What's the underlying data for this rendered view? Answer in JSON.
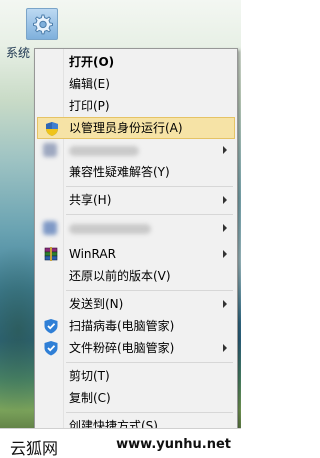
{
  "desktop": {
    "icon_label": "系统"
  },
  "context_menu": {
    "items": [
      {
        "label": "打开(O)",
        "bold": true
      },
      {
        "label": "编辑(E)"
      },
      {
        "label": "打印(P)"
      },
      {
        "label": "以管理员身份运行(A)",
        "icon": "uac-shield-icon",
        "highlighted": true
      },
      {
        "label": "",
        "blurred": true,
        "submenu": true
      },
      {
        "label": "兼容性疑难解答(Y)"
      },
      {
        "label": "共享(H)",
        "submenu": true
      },
      {
        "label": "",
        "blurred": true,
        "submenu": true
      },
      {
        "label": "WinRAR",
        "icon": "winrar-books-icon",
        "submenu": true
      },
      {
        "label": "还原以前的版本(V)"
      },
      {
        "label": "发送到(N)",
        "submenu": true
      },
      {
        "label": "扫描病毒(电脑管家)",
        "icon": "pc-manager-shield-icon"
      },
      {
        "label": "文件粉碎(电脑管家)",
        "icon": "pc-manager-shield-icon",
        "submenu": true
      },
      {
        "label": "剪切(T)"
      },
      {
        "label": "复制(C)"
      },
      {
        "label": "创建快捷方式(S)",
        "partial": true
      }
    ]
  },
  "watermark": {
    "left_text": "云狐网",
    "right_text": "www.yunhu.net"
  },
  "colors": {
    "menu_background": "#f1f1f1",
    "highlight_background": "#f6e3a6",
    "highlight_border": "#e5c365",
    "pc_manager_blue": "#2f7fd6"
  }
}
